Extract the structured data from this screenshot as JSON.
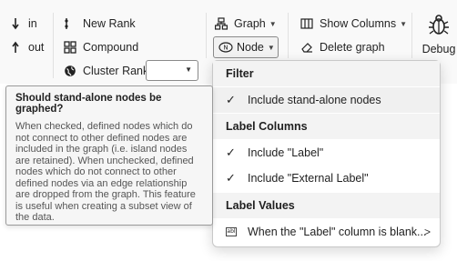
{
  "ribbon": {
    "zoom_in_label": "in",
    "zoom_out_label": "out",
    "new_rank_label": "New Rank",
    "compound_label": "Compound",
    "cluster_rank_label": "Cluster Rank",
    "cluster_rank_value": "",
    "graph_label": "Graph",
    "node_label": "Node",
    "show_columns_label": "Show Columns",
    "delete_graph_label": "Delete graph",
    "debug_label": "Debug"
  },
  "node_menu": {
    "sections": [
      {
        "title": "Filter",
        "items": [
          {
            "label": "Include stand-alone nodes",
            "checked": true,
            "icon": "checkmark-icon"
          }
        ]
      },
      {
        "title": "Label Columns",
        "items": [
          {
            "label": "Include \"Label\"",
            "checked": true,
            "icon": "checkmark-icon"
          },
          {
            "label": "Include \"External Label\"",
            "checked": true,
            "icon": "checkmark-icon"
          }
        ]
      },
      {
        "title": "Label Values",
        "items": [
          {
            "label": "When the \"Label\" column is blank...",
            "icon": "text-field-icon",
            "submenu": true,
            "submenu_glyph": ">"
          }
        ]
      }
    ]
  },
  "tooltip": {
    "title": "Should stand-alone nodes be graphed?",
    "body": "When checked, defined nodes which do not connect to other defined nodes are included in the graph (i.e. island nodes are retained). When unchecked, defined nodes which do not connect to other defined nodes via an edge relationship are dropped from the graph. This feature is useful when creating a subset view of the data."
  },
  "colors": {
    "ribbon_bg": "#f9f9f9",
    "menu_section_bg": "#f3f3f3",
    "tooltip_bg": "#f6f6f6",
    "text": "#242424"
  }
}
